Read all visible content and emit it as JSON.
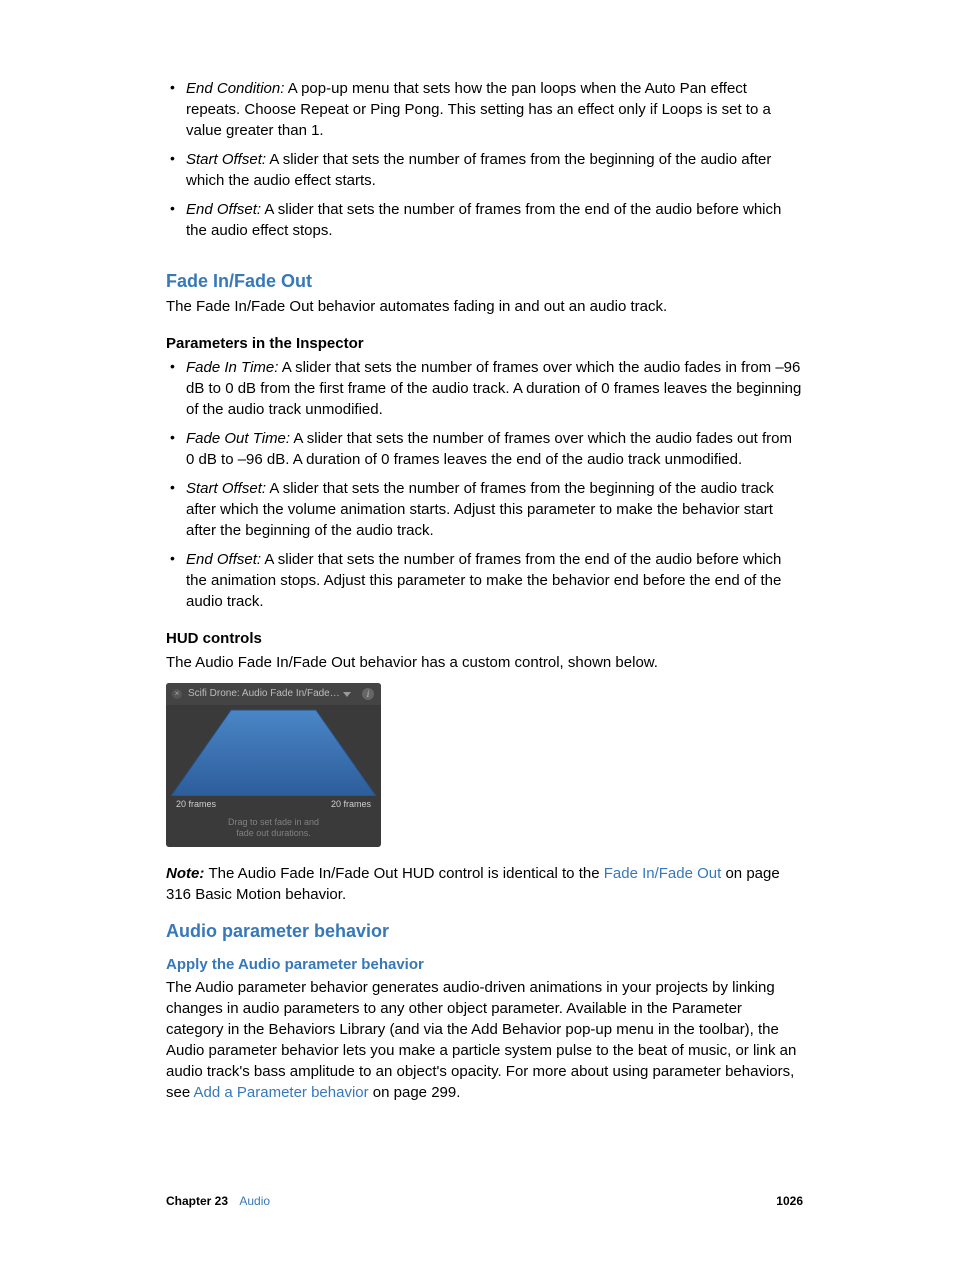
{
  "bullets_top": [
    {
      "term": "End Condition:",
      "text": " A pop-up menu that sets how the pan loops when the Auto Pan effect repeats. Choose Repeat or Ping Pong. This setting has an effect only if Loops is set to a value greater than 1."
    },
    {
      "term": "Start Offset:",
      "text": " A slider that sets the number of frames from the beginning of the audio after which the audio effect starts."
    },
    {
      "term": "End Offset:",
      "text": " A slider that sets the number of frames from the end of the audio before which the audio effect stops."
    }
  ],
  "fade": {
    "heading": "Fade In/Fade Out",
    "intro": "The Fade In/Fade Out behavior automates fading in and out an audio track.",
    "params_heading": "Parameters in the Inspector",
    "params": [
      {
        "term": "Fade In Time:",
        "text": " A slider that sets the number of frames over which the audio fades in from –96 dB to 0 dB from the first frame of the audio track. A duration of 0 frames leaves the beginning of the audio track unmodified."
      },
      {
        "term": "Fade Out Time:",
        "text": " A slider that sets the number of frames over which the audio fades out from 0 dB to –96 dB. A duration of 0 frames leaves the end of the audio track unmodified."
      },
      {
        "term": "Start Offset:",
        "text": " A slider that sets the number of frames from the beginning of the audio track after which the volume animation starts. Adjust this parameter to make the behavior start after the beginning of the audio track."
      },
      {
        "term": "End Offset:",
        "text": " A slider that sets the number of frames from the end of the audio before which the animation stops. Adjust this parameter to make the behavior end before the end of the audio track."
      }
    ],
    "hud_heading": "HUD controls",
    "hud_intro": "The Audio Fade In/Fade Out behavior has a custom control, shown below."
  },
  "hud": {
    "title": "Scifi Drone: Audio Fade In/Fade…",
    "left_label": "20 frames",
    "right_label": "20 frames",
    "hint1": "Drag to set fade in and",
    "hint2": "fade out durations."
  },
  "note": {
    "label": "Note:  ",
    "text_before": "The Audio Fade In/Fade Out HUD control is identical to the ",
    "link": "Fade In/Fade Out",
    "text_after": " on page 316 Basic Motion behavior."
  },
  "audio_param": {
    "heading": "Audio parameter behavior",
    "sub": "Apply the Audio parameter behavior",
    "body_before": "The Audio parameter behavior generates audio-driven animations in your projects by linking changes in audio parameters to any other object parameter. Available in the Parameter category in the Behaviors Library (and via the Add Behavior pop-up menu in the toolbar), the Audio parameter behavior lets you make a particle system pulse to the beat of music, or link an audio track's bass amplitude to an object's opacity. For more about using parameter behaviors, see ",
    "link": "Add a Parameter behavior",
    "body_after": " on page 299."
  },
  "footer": {
    "chapter": "Chapter 23",
    "section": "Audio",
    "page": "1026"
  }
}
